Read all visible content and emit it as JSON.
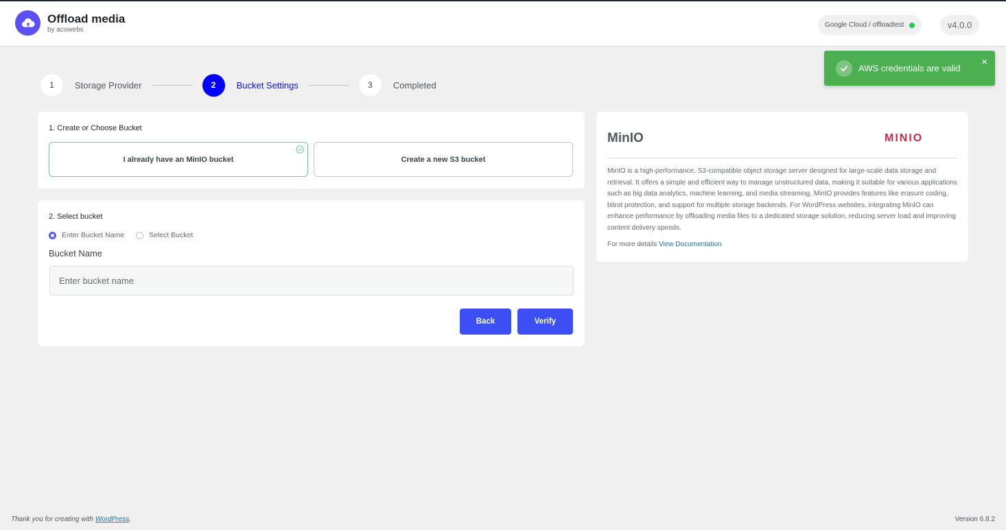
{
  "header": {
    "title": "Offload media",
    "subtitle": "by acowebs",
    "provider_label": "Google Cloud / offloadtest",
    "version": "v4.0.0"
  },
  "toast": {
    "message": "AWS credentials are valid",
    "close_symbol": "×"
  },
  "steps": [
    {
      "number": "1",
      "label": "Storage Provider",
      "active": false
    },
    {
      "number": "2",
      "label": "Bucket Settings",
      "active": true
    },
    {
      "number": "3",
      "label": "Completed",
      "active": false
    }
  ],
  "bucket_choice": {
    "title": "1. Create or Choose Bucket",
    "option_existing": "I already have an MinIO bucket",
    "option_new": "Create a new S3 bucket",
    "selected": "existing"
  },
  "bucket_select": {
    "title": "2. Select bucket",
    "radio_enter": "Enter Bucket Name",
    "radio_select": "Select Bucket",
    "selected_radio": "enter",
    "field_label": "Bucket Name",
    "input_value": "",
    "input_placeholder": "Enter bucket name",
    "back_label": "Back",
    "verify_label": "Verify"
  },
  "info": {
    "title": "MinIO",
    "logo_text": "MINIO",
    "description": "MinIO is a high-performance, S3-compatible object storage server designed for large-scale data storage and retrieval. It offers a simple and efficient way to manage unstructured data, making it suitable for various applications such as big data analytics, machine learning, and media streaming. MinIO provides features like erasure coding, bitrot protection, and support for multiple storage backends. For WordPress websites, integrating MinIO can enhance performance by offloading media files to a dedicated storage solution, reducing server load and improving content delivery speeds.",
    "more_prefix": "For more details",
    "more_link": "View Documentation"
  },
  "footer": {
    "thanks_prefix": "Thank you for creating with",
    "wp_link": "WordPress",
    "thanks_suffix": ".",
    "version": "Version 6.8.2"
  },
  "colors": {
    "accent": "#3b4ff5",
    "step_active": "#0000ff",
    "toast": "#4caf50",
    "selected_border": "#5bd49a",
    "status_online": "#1ed14b",
    "minio_brand": "#c72c48"
  },
  "icons": {
    "logo": "cloud-upload-icon",
    "toast": "check-circle-icon",
    "choice_selected": "check-circle-icon",
    "close": "close-icon"
  }
}
